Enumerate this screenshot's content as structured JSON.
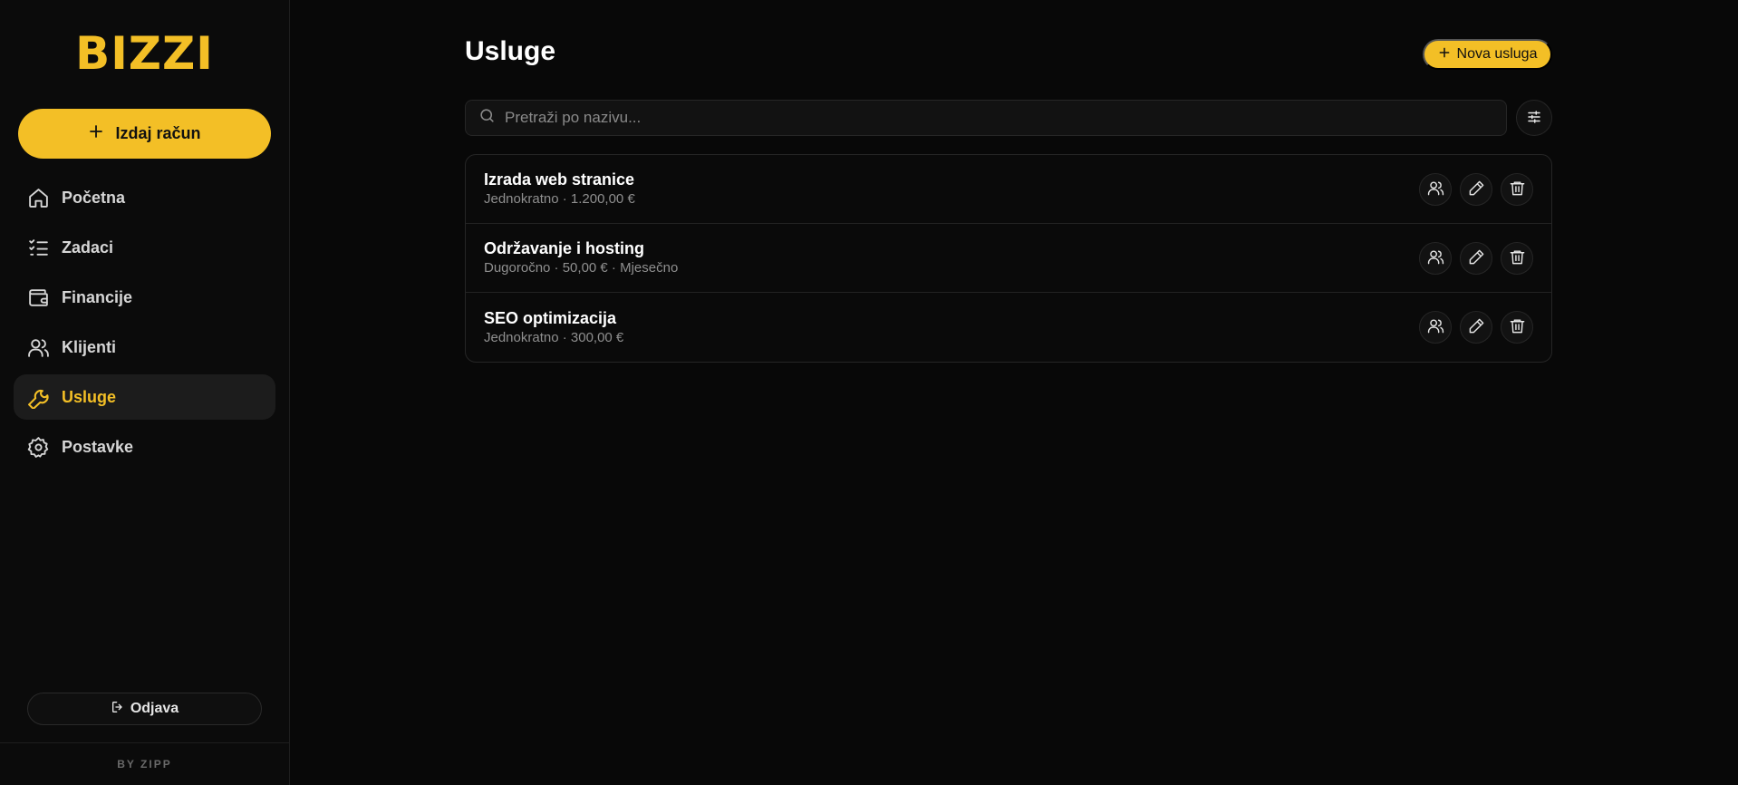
{
  "app": {
    "logo": "BIZZI",
    "byline": "BY ZIPP"
  },
  "sidebar": {
    "issue_button": "Izdaj račun",
    "items": [
      {
        "label": "Početna",
        "icon": "home-icon"
      },
      {
        "label": "Zadaci",
        "icon": "checklist-icon"
      },
      {
        "label": "Financije",
        "icon": "wallet-icon"
      },
      {
        "label": "Klijenti",
        "icon": "users-icon"
      },
      {
        "label": "Usluge",
        "icon": "wrench-icon",
        "active": true
      },
      {
        "label": "Postavke",
        "icon": "gear-icon"
      }
    ],
    "logout": "Odjava"
  },
  "main": {
    "title": "Usluge",
    "new_button": "Nova usluga",
    "search": {
      "placeholder": "Pretraži po nazivu...",
      "value": ""
    },
    "services": [
      {
        "name": "Izrada web stranice",
        "meta": "Jednokratno · 1.200,00 €"
      },
      {
        "name": "Održavanje i hosting",
        "meta": "Dugoročno · 50,00 € · Mjesečno"
      },
      {
        "name": "SEO optimizacija",
        "meta": "Jednokratno · 300,00 €"
      }
    ]
  },
  "colors": {
    "accent": "#f3bf26",
    "background": "#080808",
    "sidebar": "#0b0b0b"
  }
}
